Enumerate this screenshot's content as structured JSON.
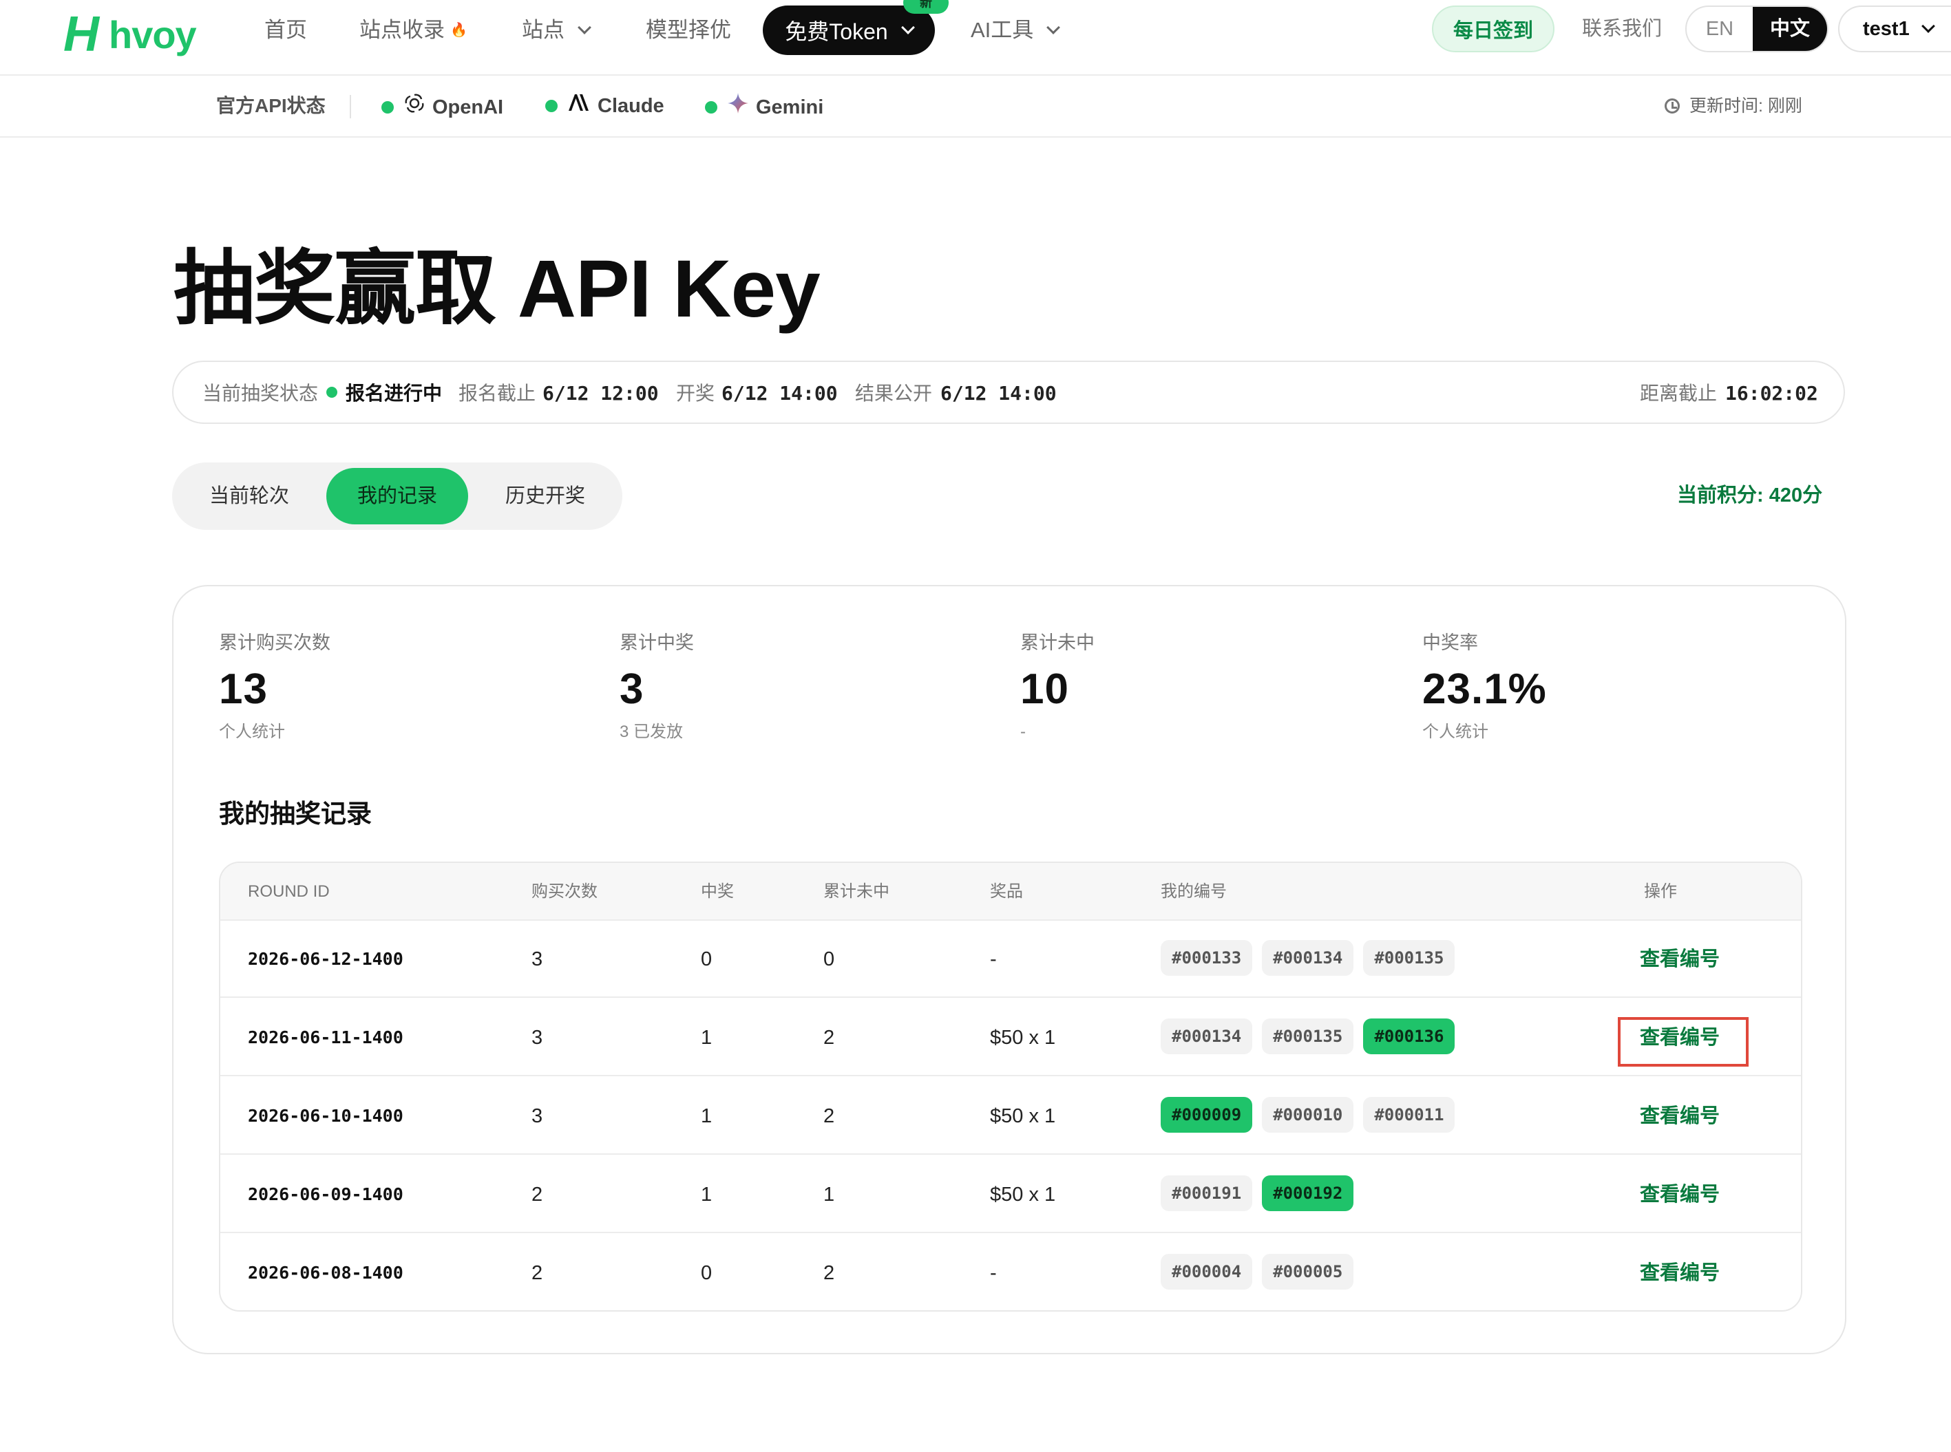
{
  "nav": {
    "logo_mark": "H",
    "logo_text": "hvoy",
    "home": "首页",
    "sites_index": "站点收录",
    "sites_index_badge": "🔥",
    "sites": "站点",
    "model_select": "模型择优",
    "free_token": "免费Token",
    "free_token_badge": "新",
    "ai_tools": "AI工具",
    "daily_checkin": "每日签到",
    "contact": "联系我们",
    "lang_en": "EN",
    "lang_zh": "中文",
    "user": "test1"
  },
  "status_bar": {
    "label": "官方API状态",
    "services": [
      {
        "name": "OpenAI",
        "status_color": "#1fc36a"
      },
      {
        "name": "Claude",
        "status_color": "#1fc36a"
      },
      {
        "name": "Gemini",
        "status_color": "#1fc36a"
      }
    ],
    "updated": "更新时间: 刚刚"
  },
  "headline": "抽奖赢取 API Key",
  "lottery_info": {
    "state_label": "当前抽奖状态",
    "state_value": "报名进行中",
    "signup_deadline_label": "报名截止",
    "signup_deadline": "6/12 12:00",
    "draw_label": "开奖",
    "draw_time": "6/12 14:00",
    "result_label": "结果公开",
    "result_time": "6/12 14:00",
    "countdown_label": "距离截止",
    "countdown": "16:02:02"
  },
  "tabs": [
    "当前轮次",
    "我的记录",
    "历史开奖"
  ],
  "active_tab": "我的记录",
  "points": "当前积分: 420分",
  "stats": [
    {
      "label": "累计购买次数",
      "value": "13",
      "sub": "个人统计"
    },
    {
      "label": "累计中奖",
      "value": "3",
      "sub": "3 已发放"
    },
    {
      "label": "累计未中",
      "value": "10",
      "sub": "-"
    },
    {
      "label": "中奖率",
      "value": "23.1%",
      "sub": "个人统计"
    }
  ],
  "records_title": "我的抽奖记录",
  "table": {
    "headers": [
      "ROUND ID",
      "购买次数",
      "中奖",
      "累计未中",
      "奖品",
      "我的编号",
      "操作"
    ],
    "rows": [
      {
        "round_id": "2026-06-12-1400",
        "purchases": "3",
        "wins": "0",
        "misses": "0",
        "prize": "-",
        "numbers": [
          {
            "n": "#000133",
            "win": false
          },
          {
            "n": "#000134",
            "win": false
          },
          {
            "n": "#000135",
            "win": false
          }
        ],
        "action": "查看编号"
      },
      {
        "round_id": "2026-06-11-1400",
        "purchases": "3",
        "wins": "1",
        "misses": "2",
        "prize": "$50 x 1",
        "numbers": [
          {
            "n": "#000134",
            "win": false
          },
          {
            "n": "#000135",
            "win": false
          },
          {
            "n": "#000136",
            "win": true
          }
        ],
        "action": "查看编号"
      },
      {
        "round_id": "2026-06-10-1400",
        "purchases": "3",
        "wins": "1",
        "misses": "2",
        "prize": "$50 x 1",
        "numbers": [
          {
            "n": "#000009",
            "win": true
          },
          {
            "n": "#000010",
            "win": false
          },
          {
            "n": "#000011",
            "win": false
          }
        ],
        "action": "查看编号"
      },
      {
        "round_id": "2026-06-09-1400",
        "purchases": "2",
        "wins": "1",
        "misses": "1",
        "prize": "$50 x 1",
        "numbers": [
          {
            "n": "#000191",
            "win": false
          },
          {
            "n": "#000192",
            "win": true
          }
        ],
        "action": "查看编号"
      },
      {
        "round_id": "2026-06-08-1400",
        "purchases": "2",
        "wins": "0",
        "misses": "2",
        "prize": "-",
        "numbers": [
          {
            "n": "#000004",
            "win": false
          },
          {
            "n": "#000005",
            "win": false
          }
        ],
        "action": "查看编号"
      }
    ]
  },
  "colors": {
    "accent": "#1fc36a",
    "accent_dark": "#0a7a3e",
    "highlight": "#e0483b"
  }
}
